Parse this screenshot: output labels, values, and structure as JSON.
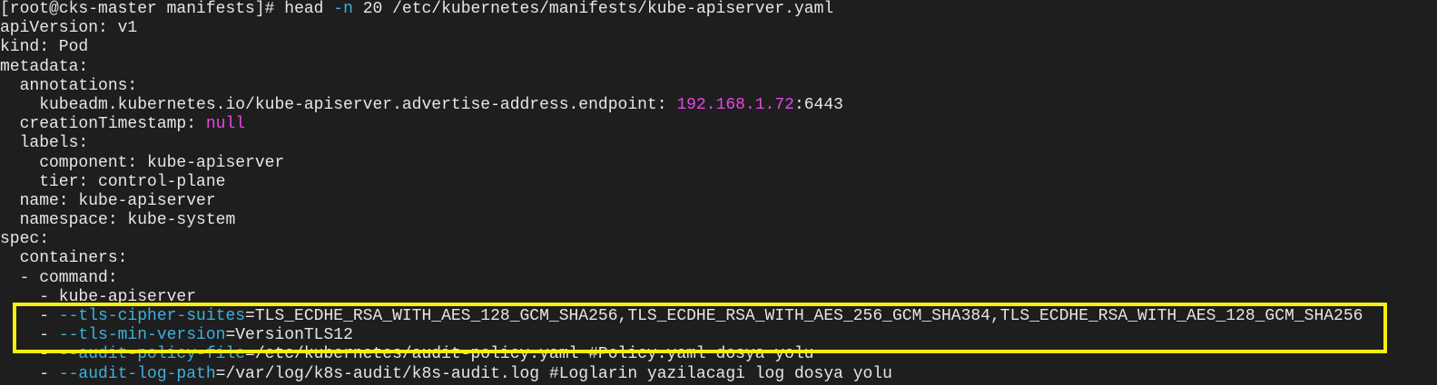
{
  "terminal": {
    "prompt": "[root@cks-master manifests]# ",
    "command": {
      "cmd": "head ",
      "flag": "-n",
      "rest": " 20 /etc/kubernetes/manifests/kube-apiserver.yaml"
    },
    "lines": [
      "apiVersion: v1",
      "kind: Pod",
      "metadata:",
      "  annotations:"
    ],
    "endpoint": {
      "key": "    kubeadm.kubernetes.io/kube-apiserver.advertise-address.endpoint: ",
      "ip": "192.168.1.72",
      "port": ":6443"
    },
    "creation": {
      "key": "  creationTimestamp: ",
      "value": "null"
    },
    "lines2": [
      "  labels:",
      "    component: kube-apiserver",
      "    tier: control-plane",
      "  name: kube-apiserver",
      "  namespace: kube-system",
      "spec:",
      "  containers:",
      "  - command:",
      "    - kube-apiserver"
    ],
    "args": [
      {
        "prefix": "    - ",
        "flag": "--tls-cipher-suites",
        "value": "=TLS_ECDHE_RSA_WITH_AES_128_GCM_SHA256,TLS_ECDHE_RSA_WITH_AES_256_GCM_SHA384,TLS_ECDHE_RSA_WITH_AES_128_GCM_SHA256"
      },
      {
        "prefix": "    - ",
        "flag": "--tls-min-version",
        "value": "=VersionTLS12"
      },
      {
        "prefix": "    - ",
        "flag": "--audit-policy-file",
        "value": "=/etc/kubernetes/audit-policy.yaml #Policy.yaml dosya yolu"
      },
      {
        "prefix": "    - ",
        "flag": "--audit-log-path",
        "value": "=/var/log/k8s-audit/k8s-audit.log #Loglarin yazilacagi log dosya yolu"
      }
    ]
  },
  "colors": {
    "background": "#1e1e1e",
    "option": "#3fb0dc",
    "value": "#e845e8",
    "highlight": "#f5ee10"
  }
}
